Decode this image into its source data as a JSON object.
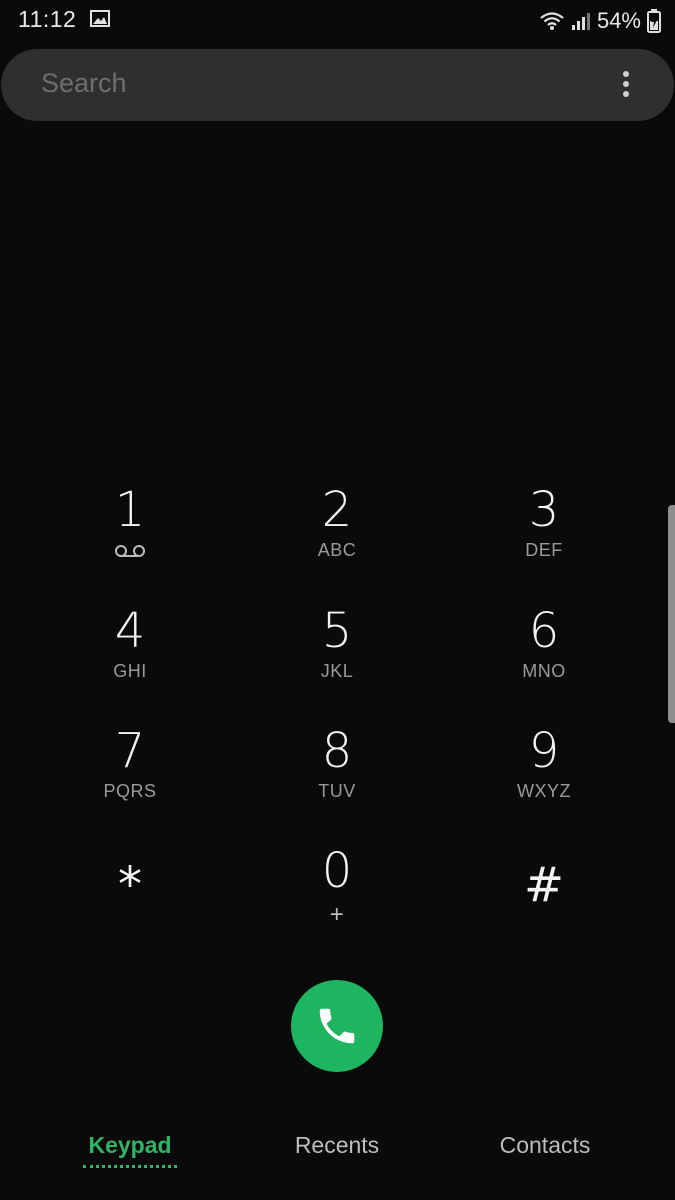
{
  "status_bar": {
    "time": "11:12",
    "battery_percent": "54%",
    "icons": [
      "gallery-icon",
      "wifi-icon",
      "signal-icon",
      "battery-charging-icon"
    ]
  },
  "search": {
    "placeholder": "Search",
    "more_icon": "more-vertical-icon"
  },
  "keypad": {
    "keys": [
      {
        "digit": "1",
        "letters": "",
        "icon": "voicemail-icon"
      },
      {
        "digit": "2",
        "letters": "ABC"
      },
      {
        "digit": "3",
        "letters": "DEF"
      },
      {
        "digit": "4",
        "letters": "GHI"
      },
      {
        "digit": "5",
        "letters": "JKL"
      },
      {
        "digit": "6",
        "letters": "MNO"
      },
      {
        "digit": "7",
        "letters": "PQRS"
      },
      {
        "digit": "8",
        "letters": "TUV"
      },
      {
        "digit": "9",
        "letters": "WXYZ"
      },
      {
        "digit": "*",
        "letters": ""
      },
      {
        "digit": "0",
        "letters": "+"
      },
      {
        "digit": "#",
        "letters": ""
      }
    ]
  },
  "call_button": {
    "icon": "phone-icon",
    "color": "#1db55f"
  },
  "tabs": {
    "items": [
      {
        "label": "Keypad",
        "active": true
      },
      {
        "label": "Recents",
        "active": false
      },
      {
        "label": "Contacts",
        "active": false
      }
    ],
    "active_color": "#2fb466"
  },
  "colors": {
    "background": "#0a0a0a",
    "search_bar": "#2f2f2f"
  }
}
